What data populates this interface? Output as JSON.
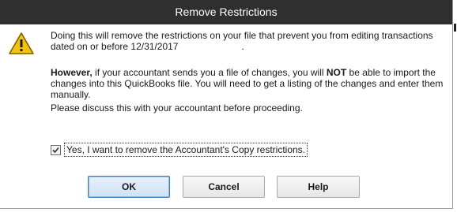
{
  "window": {
    "title": "Remove Restrictions"
  },
  "message": {
    "line1": "Doing this will remove the restrictions on your file that prevent you from editing transactions dated on or before 12/31/2017",
    "line1_suffix": ".",
    "para2_bold_prefix": "However,",
    "para2_part1": " if your accountant sends you a file of changes, you will ",
    "para2_bold_not": "NOT",
    "para2_part2": " be able to import the changes into this QuickBooks file. You will need to get a listing of the changes and enter them manually.",
    "para3": "Please discuss this with your accountant before proceeding."
  },
  "checkbox": {
    "label": "Yes, I want to remove the Accountant's Copy restrictions.",
    "checked": true
  },
  "buttons": {
    "ok": "OK",
    "cancel": "Cancel",
    "help": "Help"
  },
  "icons": {
    "warning": "warning-icon"
  },
  "colors": {
    "titlebar": "#2f2f2f",
    "ok_border": "#3c7fc4",
    "warning_fill": "#f5c400"
  }
}
